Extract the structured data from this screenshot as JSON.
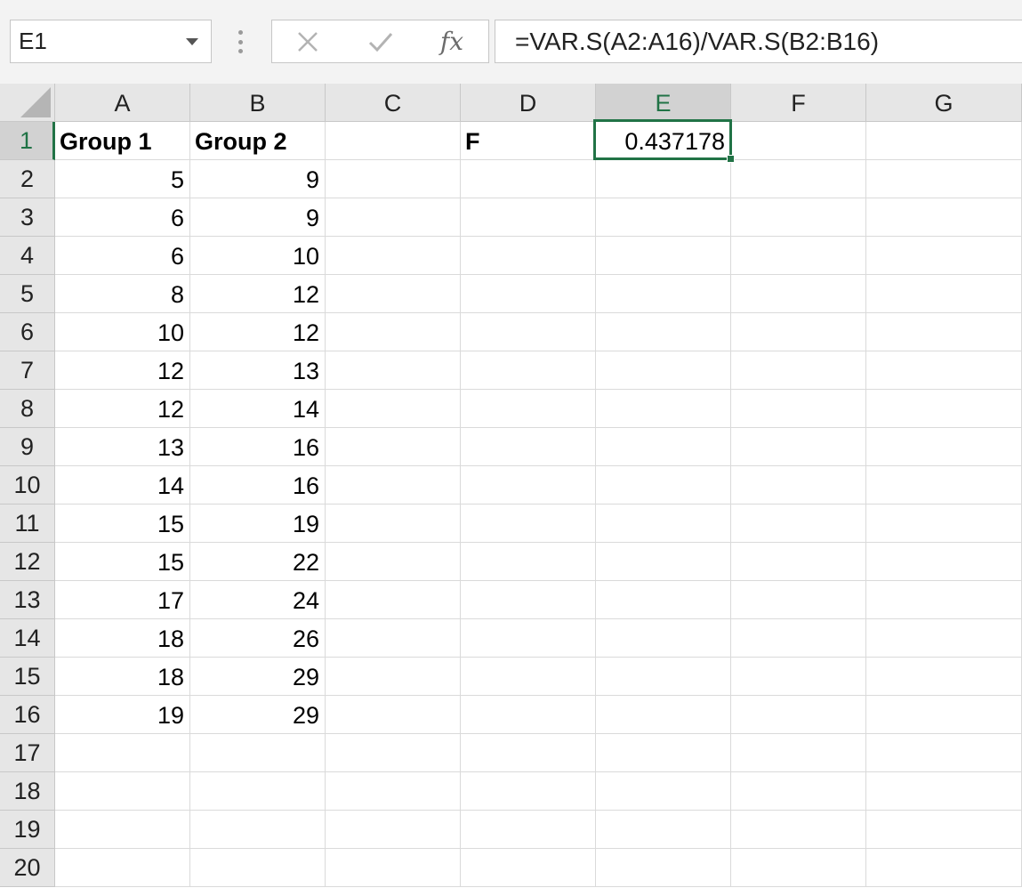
{
  "name_box": {
    "value": "E1"
  },
  "formula_bar": {
    "cancel_glyph": "✕",
    "enter_glyph": "✓",
    "fx_label": "fx",
    "formula": "=VAR.S(A2:A16)/VAR.S(B2:B16)"
  },
  "columns": [
    "A",
    "B",
    "C",
    "D",
    "E",
    "F",
    "G"
  ],
  "rows": [
    "1",
    "2",
    "3",
    "4",
    "5",
    "6",
    "7",
    "8",
    "9",
    "10",
    "11",
    "12",
    "13",
    "14",
    "15",
    "16",
    "17",
    "18",
    "19",
    "20"
  ],
  "selected_cell": "E1",
  "cells": {
    "A1": "Group 1",
    "B1": "Group 2",
    "D1": "F",
    "E1": "0.437178",
    "A2": "5",
    "B2": "9",
    "A3": "6",
    "B3": "9",
    "A4": "6",
    "B4": "10",
    "A5": "8",
    "B5": "12",
    "A6": "10",
    "B6": "12",
    "A7": "12",
    "B7": "13",
    "A8": "12",
    "B8": "14",
    "A9": "13",
    "B9": "16",
    "A10": "14",
    "B10": "16",
    "A11": "15",
    "B11": "19",
    "A12": "15",
    "B12": "22",
    "A13": "17",
    "B13": "24",
    "A14": "18",
    "B14": "26",
    "A15": "18",
    "B15": "29",
    "A16": "19",
    "B16": "29"
  },
  "colors": {
    "accent": "#217346",
    "header_bg": "#e6e6e6",
    "header_active_bg": "#d2d2d2"
  }
}
